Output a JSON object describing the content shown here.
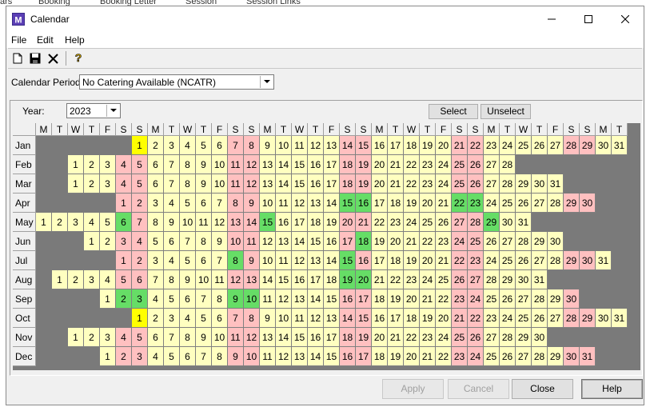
{
  "background_tabs": [
    "ars",
    "Booking",
    "Booking Letter",
    "Session",
    "Session Links"
  ],
  "window": {
    "title": "Calendar"
  },
  "menu": [
    "File",
    "Edit",
    "Help"
  ],
  "toolbar": {
    "icons": [
      "new-document-icon",
      "save-icon",
      "delete-icon",
      "help-key-icon"
    ]
  },
  "calendar_period": {
    "label": "Calendar Period:",
    "value": "No Catering Available (NCATR)"
  },
  "year": {
    "label": "Year:",
    "value": "2023"
  },
  "buttons": {
    "select": "Select",
    "unselect": "Unselect",
    "apply": "Apply",
    "cancel": "Cancel",
    "close": "Close",
    "help": "Help"
  },
  "day_headers": [
    "M",
    "T",
    "W",
    "T",
    "F",
    "S",
    "S",
    "M",
    "T",
    "W",
    "T",
    "F",
    "S",
    "S",
    "M",
    "T",
    "W",
    "T",
    "F",
    "S",
    "S",
    "M",
    "T",
    "W",
    "T",
    "F",
    "S",
    "S",
    "M",
    "T",
    "W",
    "T",
    "F",
    "S",
    "S",
    "M",
    "T"
  ],
  "colors": {
    "weekday": "#ffffc0",
    "weekend": "#ffc0c0",
    "holiday": "#66dd66",
    "selected": "#ffff00",
    "empty": "#7a7a7a"
  },
  "months": [
    {
      "name": "Jan",
      "start": 6,
      "days": 31,
      "holidays": [],
      "selected": [
        1
      ]
    },
    {
      "name": "Feb",
      "start": 2,
      "days": 28,
      "holidays": [],
      "selected": []
    },
    {
      "name": "Mar",
      "start": 2,
      "days": 31,
      "holidays": [],
      "selected": []
    },
    {
      "name": "Apr",
      "start": 5,
      "days": 30,
      "holidays": [
        15,
        16,
        22,
        23
      ],
      "selected": []
    },
    {
      "name": "May",
      "start": 0,
      "days": 31,
      "holidays": [
        6,
        15,
        29
      ],
      "selected": []
    },
    {
      "name": "Jun",
      "start": 3,
      "days": 30,
      "holidays": [
        18
      ],
      "selected": []
    },
    {
      "name": "Jul",
      "start": 5,
      "days": 31,
      "holidays": [
        8,
        15
      ],
      "selected": []
    },
    {
      "name": "Aug",
      "start": 1,
      "days": 31,
      "holidays": [
        19,
        20
      ],
      "selected": []
    },
    {
      "name": "Sep",
      "start": 4,
      "days": 30,
      "holidays": [
        2,
        3,
        9,
        10
      ],
      "selected": []
    },
    {
      "name": "Oct",
      "start": 6,
      "days": 31,
      "holidays": [],
      "selected": [
        1
      ]
    },
    {
      "name": "Nov",
      "start": 2,
      "days": 30,
      "holidays": [],
      "selected": []
    },
    {
      "name": "Dec",
      "start": 4,
      "days": 31,
      "holidays": [],
      "selected": []
    }
  ]
}
